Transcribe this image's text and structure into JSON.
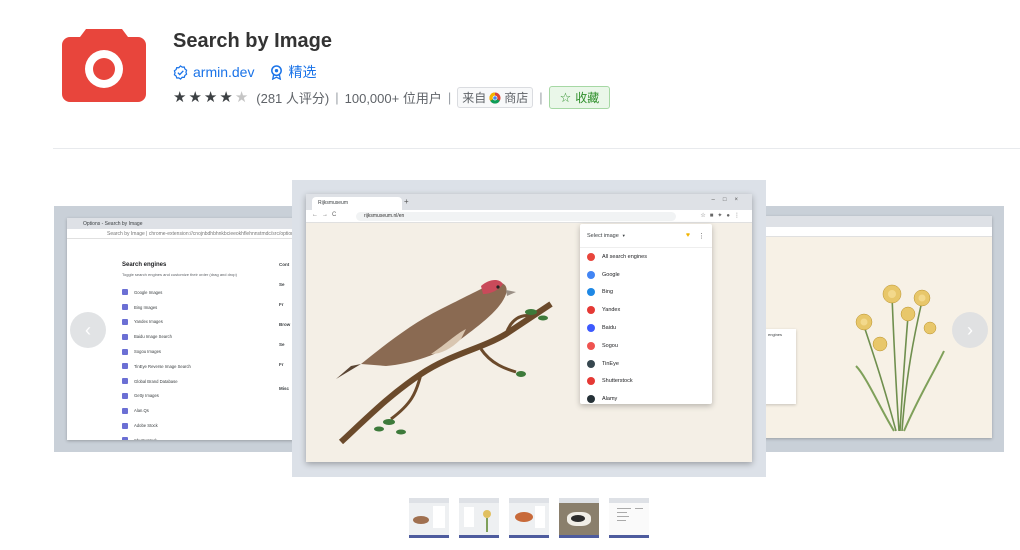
{
  "header": {
    "title": "Search by Image",
    "developer": "armin.dev",
    "featured": "精选",
    "rating_value": 4.5,
    "rating_count": "(281 人评分)",
    "users": "100,000+ 位用户",
    "store_prefix": "来自",
    "store_suffix": "商店",
    "favorite": "收藏",
    "colors": {
      "icon_bg": "#e8453c",
      "link": "#1a73e8",
      "fav_green": "#2f8f2b"
    }
  },
  "carousel": {
    "left_slide": {
      "tab": "Options - Search by Image",
      "url": "Search by Image | chrome-extension://cnojnbdhbhnkbcieeokhflehnnstmdc/src/options/index",
      "heading": "Search engines",
      "subheading": "Toggle search engines and customize their order (drag and drop)",
      "engines": [
        "Google Images",
        "Bing Images",
        "Yandex Images",
        "Baidu Image Search",
        "Sogou Images",
        "TinEye Reverse Image Search",
        "Global Brand Database",
        "Getty Images",
        "Alan.Qs",
        "Adobe Stock",
        "Shutterstock"
      ],
      "right_col": [
        "Cont",
        "Se",
        "Fr",
        "Brow",
        "Se",
        "Fr",
        "Misc"
      ]
    },
    "center_slide": {
      "tab": "Rijksmuseum",
      "url": "rijksmuseum.nl/en",
      "popup_title": "Select image",
      "engines": [
        {
          "name": "All search engines",
          "icon": "all-engines-icon",
          "color": "#e8453c"
        },
        {
          "name": "Google",
          "icon": "google-icon",
          "color": "#4285f4"
        },
        {
          "name": "Bing",
          "icon": "bing-icon",
          "color": "#1e88e5"
        },
        {
          "name": "Yandex",
          "icon": "yandex-icon",
          "color": "#e53935"
        },
        {
          "name": "Baidu",
          "icon": "baidu-icon",
          "color": "#3d5afe"
        },
        {
          "name": "Sogou",
          "icon": "sogou-icon",
          "color": "#ef5350"
        },
        {
          "name": "TinEye",
          "icon": "tineye-icon",
          "color": "#37474f"
        },
        {
          "name": "Shutterstock",
          "icon": "shutterstock-icon",
          "color": "#e53935"
        },
        {
          "name": "Alamy",
          "icon": "alamy-icon",
          "color": "#263238"
        }
      ]
    },
    "right_slide": {
      "popup_label": "engines"
    }
  },
  "thumbnails": [
    "thumb-1",
    "thumb-2",
    "thumb-3",
    "thumb-4",
    "thumb-5"
  ]
}
